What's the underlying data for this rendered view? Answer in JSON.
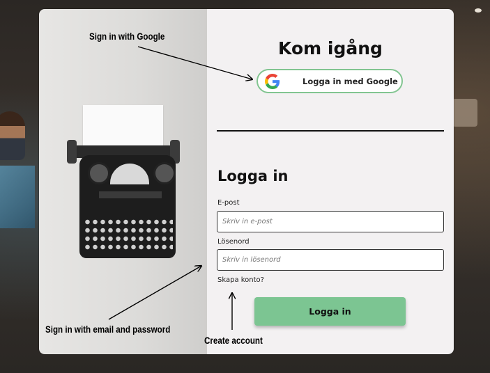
{
  "form": {
    "title": "Kom igång",
    "google_button_label": "Logga in med Google",
    "section_title": "Logga in",
    "email_label": "E-post",
    "email_placeholder": "Skriv in e-post",
    "email_value": "",
    "password_label": "Lösenord",
    "password_placeholder": "Skriv in lösenord",
    "password_value": "",
    "create_account_link": "Skapa konto?",
    "login_button_label": "Logga in"
  },
  "annotations": {
    "google": "Sign in with Google",
    "email_password": "Sign in with email and password",
    "create_account": "Create account"
  },
  "colors": {
    "accent_green": "#7cc592",
    "google_border": "#82c591",
    "panel_background": "#f3f1f2"
  },
  "icons": {
    "google": "google-g-logo"
  }
}
